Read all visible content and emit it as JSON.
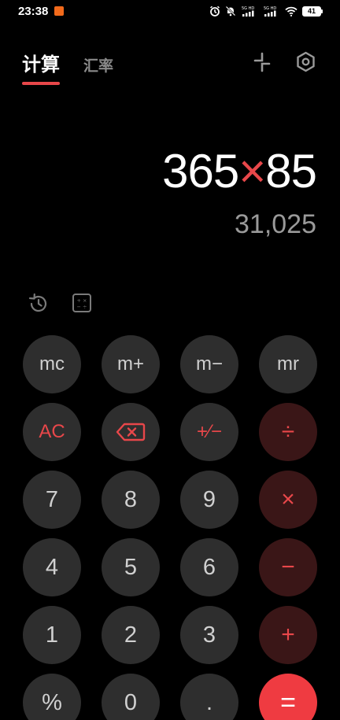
{
  "status_bar": {
    "time": "23:38",
    "battery": "41",
    "accent_color": "#f26a1b"
  },
  "tabs": [
    {
      "label": "计算",
      "active": true
    },
    {
      "label": "汇率",
      "active": false
    }
  ],
  "display": {
    "operand1": "365",
    "operator": "×",
    "operand2": "85",
    "result": "31,025"
  },
  "keys": {
    "mc": "mc",
    "mplus": "m+",
    "mminus": "m−",
    "mr": "mr",
    "ac": "AC",
    "plusminus": "+⁄−",
    "divide": "÷",
    "seven": "7",
    "eight": "8",
    "nine": "9",
    "multiply": "×",
    "four": "4",
    "five": "5",
    "six": "6",
    "minus": "−",
    "one": "1",
    "two": "2",
    "three": "3",
    "plus": "+",
    "percent": "%",
    "zero": "0",
    "dot": ".",
    "equals": "="
  },
  "colors": {
    "accent": "#e8474a",
    "key_bg": "#2e2e2e",
    "op_bg": "#3a1617",
    "equals_bg": "#ef3b41"
  },
  "icons": {
    "collapse": "collapse-arrows-icon",
    "settings": "hexagon-settings-icon",
    "history": "history-icon",
    "unit_converter": "unit-converter-icon",
    "backspace": "backspace-icon"
  }
}
